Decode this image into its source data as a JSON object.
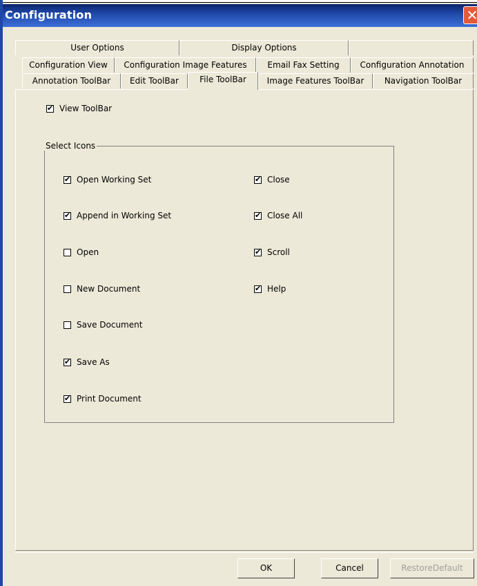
{
  "window": {
    "title": "Configuration",
    "close_glyph": "✕"
  },
  "tabs": {
    "row1": [
      "User Options",
      "Display Options",
      ""
    ],
    "row2": [
      "Configuration View",
      "Configuration Image Features",
      "Email  Fax Setting",
      "Configuration Annotation"
    ],
    "row3": [
      "Annotation ToolBar",
      "Edit ToolBar",
      "File ToolBar",
      "Image Features ToolBar",
      "Navigation ToolBar"
    ],
    "active": "File ToolBar"
  },
  "view_toolbar": {
    "label": "View ToolBar",
    "checked": true
  },
  "select_icons": {
    "legend": "Select Icons",
    "left_column": [
      {
        "label": "Open Working Set",
        "checked": true
      },
      {
        "label": "Append in Working Set",
        "checked": true
      },
      {
        "label": "Open",
        "checked": false
      },
      {
        "label": "New Document",
        "checked": false
      },
      {
        "label": "Save Document",
        "checked": false
      },
      {
        "label": "Save As",
        "checked": true
      },
      {
        "label": "Print Document",
        "checked": true
      }
    ],
    "right_column": [
      {
        "label": "Close",
        "checked": true
      },
      {
        "label": "Close All",
        "checked": true
      },
      {
        "label": "Scroll",
        "checked": true
      },
      {
        "label": "Help",
        "checked": true
      }
    ]
  },
  "buttons": {
    "ok": "OK",
    "cancel": "Cancel",
    "restore": "RestoreDefault",
    "restore_enabled": false
  }
}
